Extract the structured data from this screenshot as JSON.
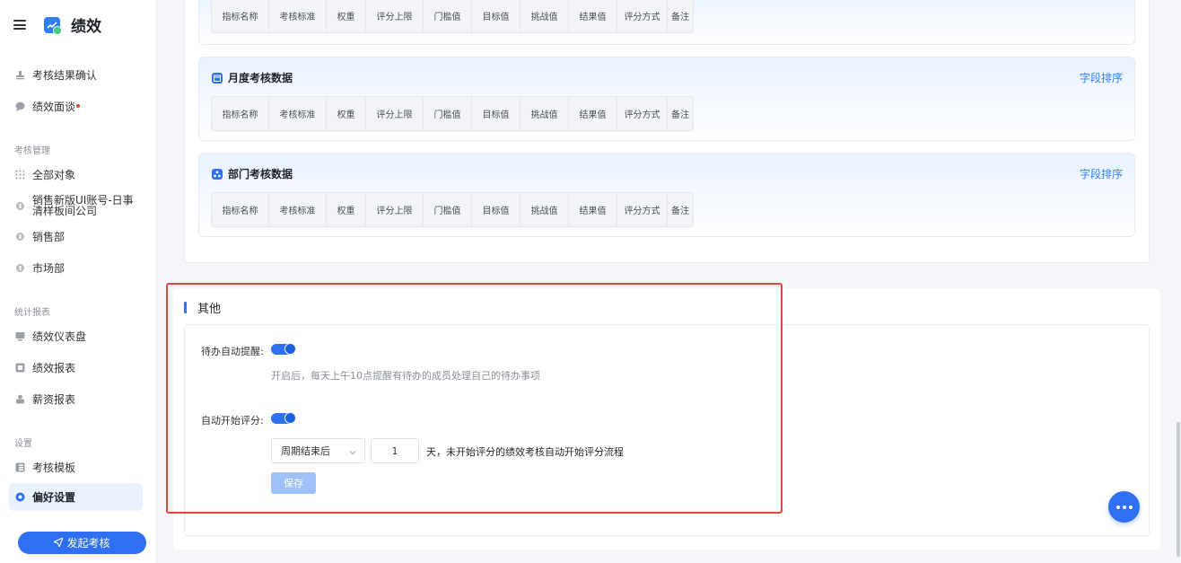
{
  "app": {
    "title": "绩效"
  },
  "sidebar": {
    "items_top": [
      {
        "label": "考核结果确认",
        "icon": "stamp-icon"
      },
      {
        "label": "绩效面谈",
        "icon": "chat-icon",
        "badge_dot": true
      }
    ],
    "section_manage": "考核管理",
    "items_manage": [
      {
        "label": "全部对象",
        "icon": "grid-dots-icon"
      },
      {
        "label": "销售新版UI账号-日事清样板间公司",
        "icon": "org-icon"
      },
      {
        "label": "销售部",
        "icon": "org-icon"
      },
      {
        "label": "市场部",
        "icon": "org-icon"
      }
    ],
    "section_reports": "统计报表",
    "items_reports": [
      {
        "label": "绩效仪表盘",
        "icon": "monitor-icon"
      },
      {
        "label": "绩效报表",
        "icon": "report-icon"
      },
      {
        "label": "薪资报表",
        "icon": "money-icon"
      }
    ],
    "section_settings": "设置",
    "items_settings": [
      {
        "label": "考核模板",
        "icon": "template-icon"
      },
      {
        "label": "偏好设置",
        "icon": "settings-icon",
        "active": true
      }
    ],
    "launch_button": "发起考核"
  },
  "columns": [
    "指标名称",
    "考核标准",
    "权重",
    "评分上限",
    "门槛值",
    "目标值",
    "挑战值",
    "结果值",
    "评分方式",
    "备注"
  ],
  "data_cards": [
    {
      "title": "",
      "icon": ""
    },
    {
      "title": "月度考核数据",
      "icon": "calendar-icon",
      "sort_label": "字段排序"
    },
    {
      "title": "部门考核数据",
      "icon": "department-icon",
      "sort_label": "字段排序"
    }
  ],
  "other": {
    "section_title": "其他",
    "auto_reminder": {
      "label": "待办自动提醒:",
      "enabled": true,
      "hint": "开启后，每天上午10点提醒有待办的成员处理自己的待办事项"
    },
    "auto_scoring": {
      "label": "自动开始评分:",
      "enabled": true,
      "select_value": "周期结束后",
      "days_value": "1",
      "suffix_text": "天，未开始评分的绩效考核自动开始评分流程"
    },
    "save_label": "保存"
  },
  "colors": {
    "accent": "#2f6ff2",
    "link": "#2f7ef7",
    "highlight_border": "#e04c3a"
  }
}
